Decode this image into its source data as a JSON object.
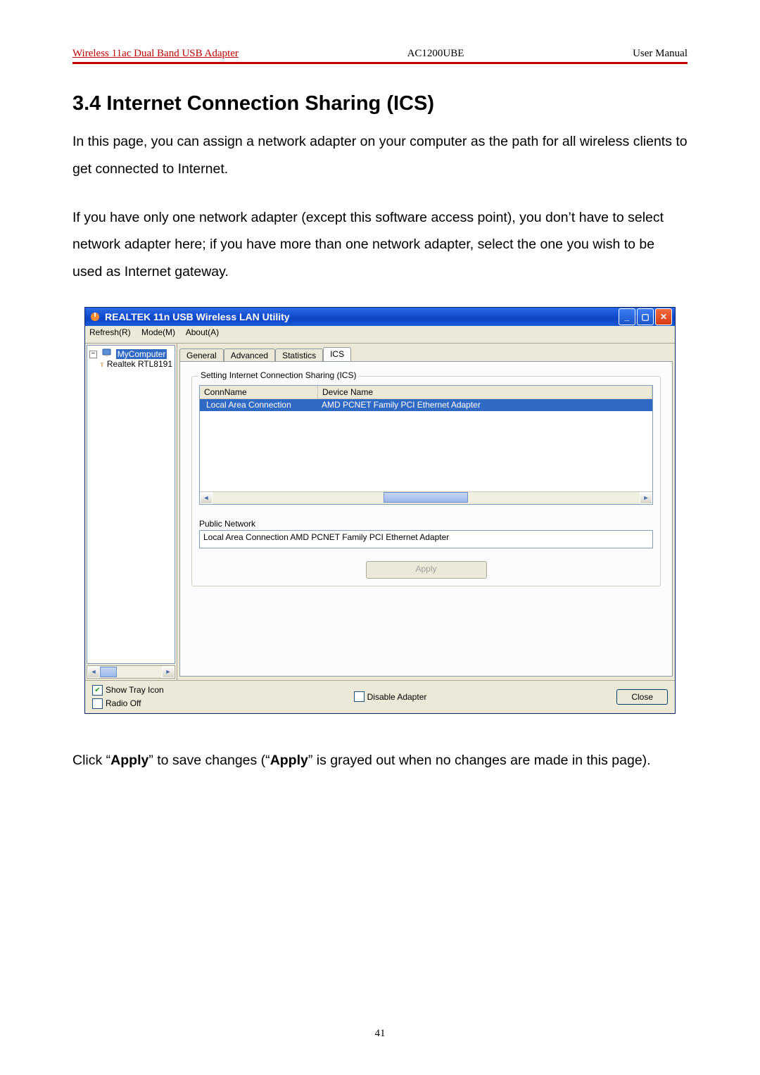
{
  "header": {
    "left": "Wireless 11ac Dual Band USB Adapter",
    "mid": "AC1200UBE",
    "right": "User Manual"
  },
  "section_title": "3.4 Internet Connection Sharing (ICS)",
  "para1": "In this page, you can assign a network adapter on your computer as the path for all wireless clients to get connected to Internet.",
  "para2": "If you have only one network adapter (except this software access point), you don’t have to select network adapter here; if you have more than one network adapter, select the one you wish to be used as Internet gateway.",
  "note_pre": "Click “",
  "note_b1": "Apply",
  "note_mid": "” to save changes (“",
  "note_b2": "Apply",
  "note_post": "” is grayed out when no changes are made in this page).",
  "page_number": "41",
  "window": {
    "title": "REALTEK 11n USB Wireless LAN Utility",
    "menu": {
      "refresh": "Refresh(R)",
      "mode": "Mode(M)",
      "about": "About(A)"
    },
    "tree": {
      "root": "MyComputer",
      "child": "Realtek RTL8191"
    },
    "tabs": {
      "general": "General",
      "advanced": "Advanced",
      "statistics": "Statistics",
      "ics": "ICS"
    },
    "groupbox": "Setting Internet Connection Sharing (ICS)",
    "list": {
      "col_conn": "ConnName",
      "col_dev": "Device Name",
      "row_conn": "Local Area Connection",
      "row_dev": "AMD PCNET Family PCI Ethernet Adapter"
    },
    "public_label": "Public Network",
    "public_value": "Local Area Connection AMD PCNET Family PCI Ethernet Adapter",
    "apply": "Apply",
    "bottom": {
      "tray": "Show Tray Icon",
      "radio": "Radio Off",
      "disable": "Disable Adapter",
      "close": "Close"
    }
  }
}
